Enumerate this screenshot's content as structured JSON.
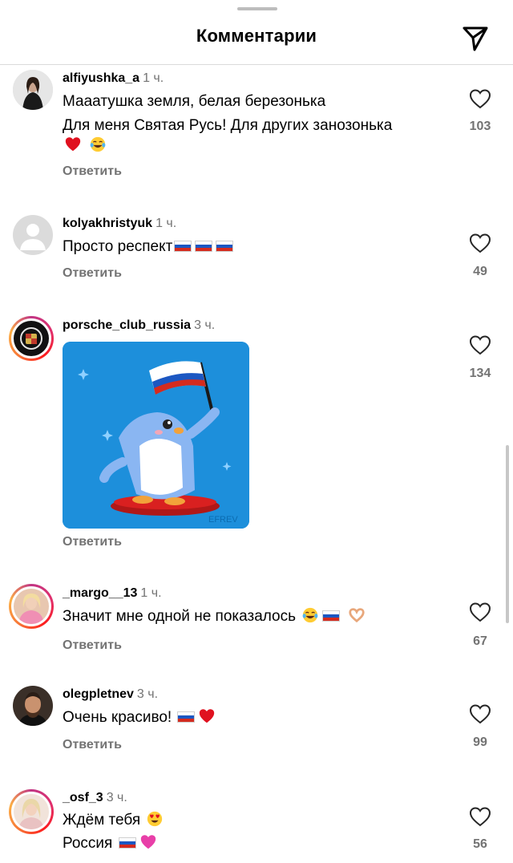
{
  "header": {
    "title": "Комментарии",
    "share_icon": "send-icon"
  },
  "comments": [
    {
      "username": "alfiyushka_a",
      "time": "1 ч.",
      "lines": [
        "Мааатушка земля, белая березонька",
        "Для меня Святая Русь! Для других занозонька"
      ],
      "emoji_line": [
        "red-heart",
        "tears-of-joy"
      ],
      "reply": "Ответить",
      "likes": "103"
    },
    {
      "username": "kolyakhristyuk",
      "time": "1 ч.",
      "lines": [
        "Просто респект"
      ],
      "reply": "Ответить",
      "likes": "49"
    },
    {
      "username": "porsche_club_russia",
      "time": "3 ч.",
      "sticker": "penguin-with-russian-flag",
      "sticker_watermark": "EFREV",
      "reply": "Ответить",
      "likes": "134"
    },
    {
      "username": "_margo__13",
      "time": "1 ч.",
      "lines": [
        "Значит мне одной не показалось"
      ],
      "reply": "Ответить",
      "likes": "67"
    },
    {
      "username": "olegpletnev",
      "time": "3 ч.",
      "lines": [
        "Очень красиво!"
      ],
      "reply": "Ответить",
      "likes": "99"
    },
    {
      "username": "_osf_3",
      "time": "3 ч.",
      "lines": [
        "Ждём тебя",
        "Россия"
      ],
      "likes": "56"
    }
  ],
  "colors": {
    "secondary_text": "#737373",
    "divider": "#dbdbdb",
    "sticker_bg": "#1d8fdb"
  }
}
